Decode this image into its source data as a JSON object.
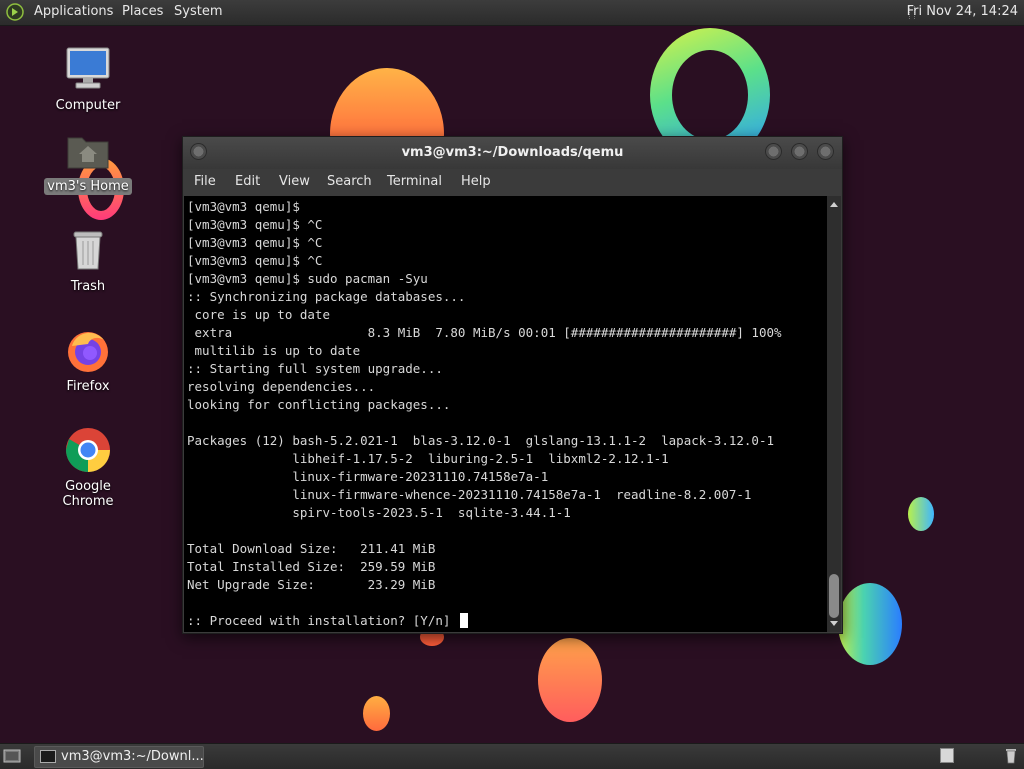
{
  "top_panel": {
    "menus": [
      "Applications",
      "Places",
      "System"
    ],
    "clock": "Fri Nov 24, 14:24"
  },
  "desktop": {
    "icons": [
      {
        "label": "Computer",
        "icon": "computer-icon"
      },
      {
        "label": "vm3's Home",
        "icon": "home-folder-icon",
        "selected": true
      },
      {
        "label": "Trash",
        "icon": "trash-icon"
      },
      {
        "label": "Firefox",
        "icon": "firefox-icon"
      },
      {
        "label": "Google Chrome",
        "icon": "chrome-icon"
      }
    ]
  },
  "terminal": {
    "title": "vm3@vm3:~/Downloads/qemu",
    "menu": [
      "File",
      "Edit",
      "View",
      "Search",
      "Terminal",
      "Help"
    ],
    "lines": [
      "[vm3@vm3 qemu]$",
      "[vm3@vm3 qemu]$ ^C",
      "[vm3@vm3 qemu]$ ^C",
      "[vm3@vm3 qemu]$ ^C",
      "[vm3@vm3 qemu]$ sudo pacman -Syu",
      ":: Synchronizing package databases...",
      " core is up to date",
      " extra                  8.3 MiB  7.80 MiB/s 00:01 [######################] 100%",
      " multilib is up to date",
      ":: Starting full system upgrade...",
      "resolving dependencies...",
      "looking for conflicting packages...",
      "",
      "Packages (12) bash-5.2.021-1  blas-3.12.0-1  glslang-13.1.1-2  lapack-3.12.0-1",
      "              libheif-1.17.5-2  liburing-2.5-1  libxml2-2.12.1-1",
      "              linux-firmware-20231110.74158e7a-1",
      "              linux-firmware-whence-20231110.74158e7a-1  readline-8.2.007-1",
      "              spirv-tools-2023.5-1  sqlite-3.44.1-1",
      "",
      "Total Download Size:   211.41 MiB",
      "Total Installed Size:  259.59 MiB",
      "Net Upgrade Size:       23.29 MiB",
      "",
      ":: Proceed with installation? [Y/n] "
    ]
  },
  "taskbar": {
    "tasks": [
      {
        "label": "vm3@vm3:~/Downl..."
      }
    ]
  },
  "colors": {
    "wallpaper": "#2a0f22",
    "terminal_bg": "#000000",
    "terminal_fg": "#d8d8d8",
    "panel": "#333333"
  }
}
